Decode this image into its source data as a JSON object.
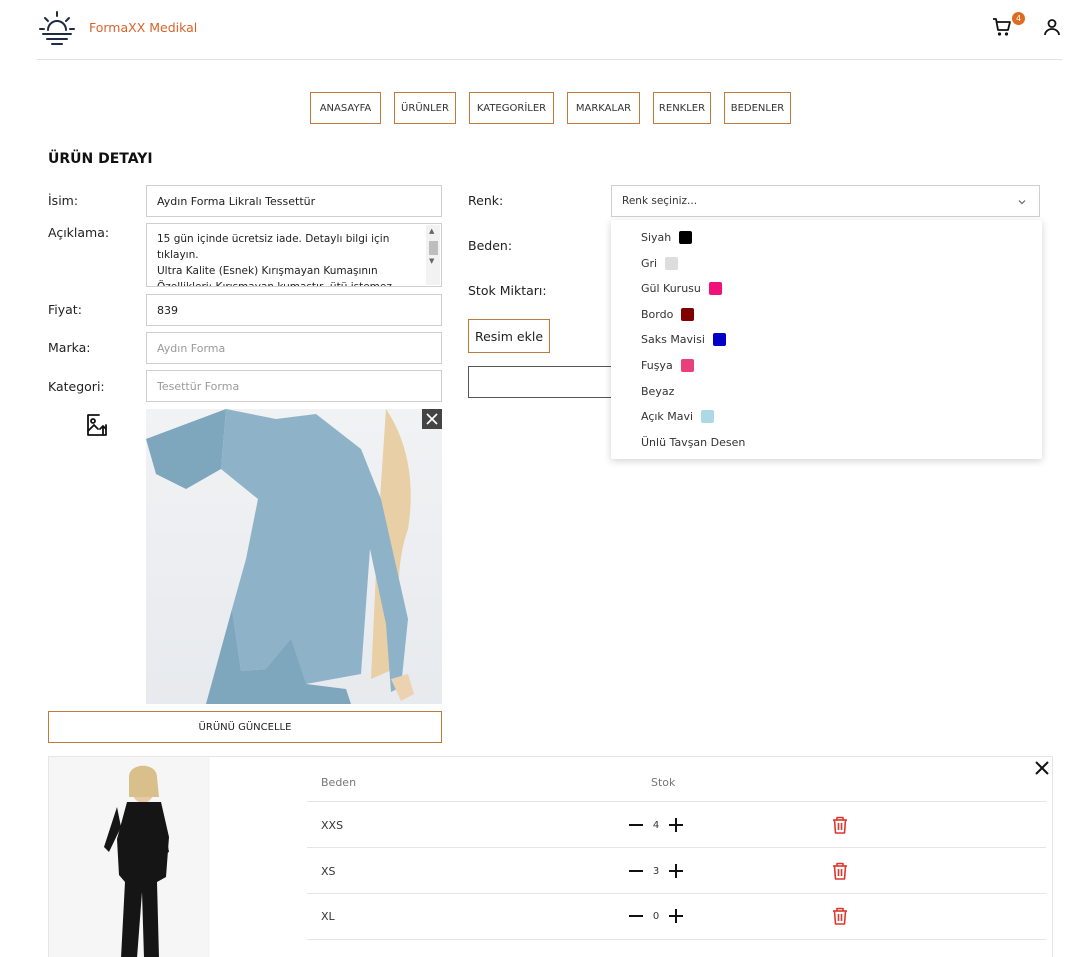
{
  "brand": {
    "name": "FormaXX Medikal",
    "color": "#d9622b"
  },
  "header": {
    "cart_count": "4",
    "cart_icon": "cart-icon",
    "user_icon": "user-icon"
  },
  "nav": [
    {
      "label": "ANASAYFA"
    },
    {
      "label": "ÜRÜNLER"
    },
    {
      "label": "KATEGORİLER"
    },
    {
      "label": "MARKALAR"
    },
    {
      "label": "RENKLER"
    },
    {
      "label": "BEDENLER"
    }
  ],
  "page_title": "ÜRÜN DETAYI",
  "form": {
    "name_label": "İsim:",
    "name_value": "Aydın Forma Likralı Tessettür",
    "desc_label": "Açıklama:",
    "desc_lines": [
      "15 gün içinde ücretsiz iade. Detaylı bilgi için",
      "tıklayın.",
      "Ultra Kalite (Esnek) Kırışmayan Kumaşının",
      "Özellikleri: Kırışmayan kumaştır, ütü istemez"
    ],
    "price_label": "Fiyat:",
    "price_value": "839",
    "brand_label": "Marka:",
    "brand_placeholder": "Aydın Forma",
    "category_label": "Kategori:",
    "category_placeholder": "Tesettür Forma",
    "update_button": "ÜRÜNÜ GÜNCELLE"
  },
  "right": {
    "color_label": "Renk:",
    "color_select_placeholder": "Renk seçiniz...",
    "size_label": "Beden:",
    "stock_label": "Stok Miktarı:",
    "image_button": "Resim ekle"
  },
  "color_options": [
    {
      "name": "Siyah",
      "color": "#000000"
    },
    {
      "name": "Gri",
      "color": "#dddddd"
    },
    {
      "name": "Gül Kurusu",
      "color": "#f0127a"
    },
    {
      "name": "Bordo",
      "color": "#800000"
    },
    {
      "name": "Saks Mavisi",
      "color": "#0000c8"
    },
    {
      "name": "Fuşya",
      "color": "#e8407a"
    },
    {
      "name": "Beyaz",
      "color": "#ffffff"
    },
    {
      "name": "Açık Mavi",
      "color": "#add8e6"
    },
    {
      "name": "Ünlü Tavşan Desen",
      "color": ""
    }
  ],
  "variant": {
    "col_size": "Beden",
    "col_stock": "Stok",
    "rows": [
      {
        "size": "XXS",
        "stock": "4"
      },
      {
        "size": "XS",
        "stock": "3"
      },
      {
        "size": "XL",
        "stock": "0"
      }
    ]
  }
}
